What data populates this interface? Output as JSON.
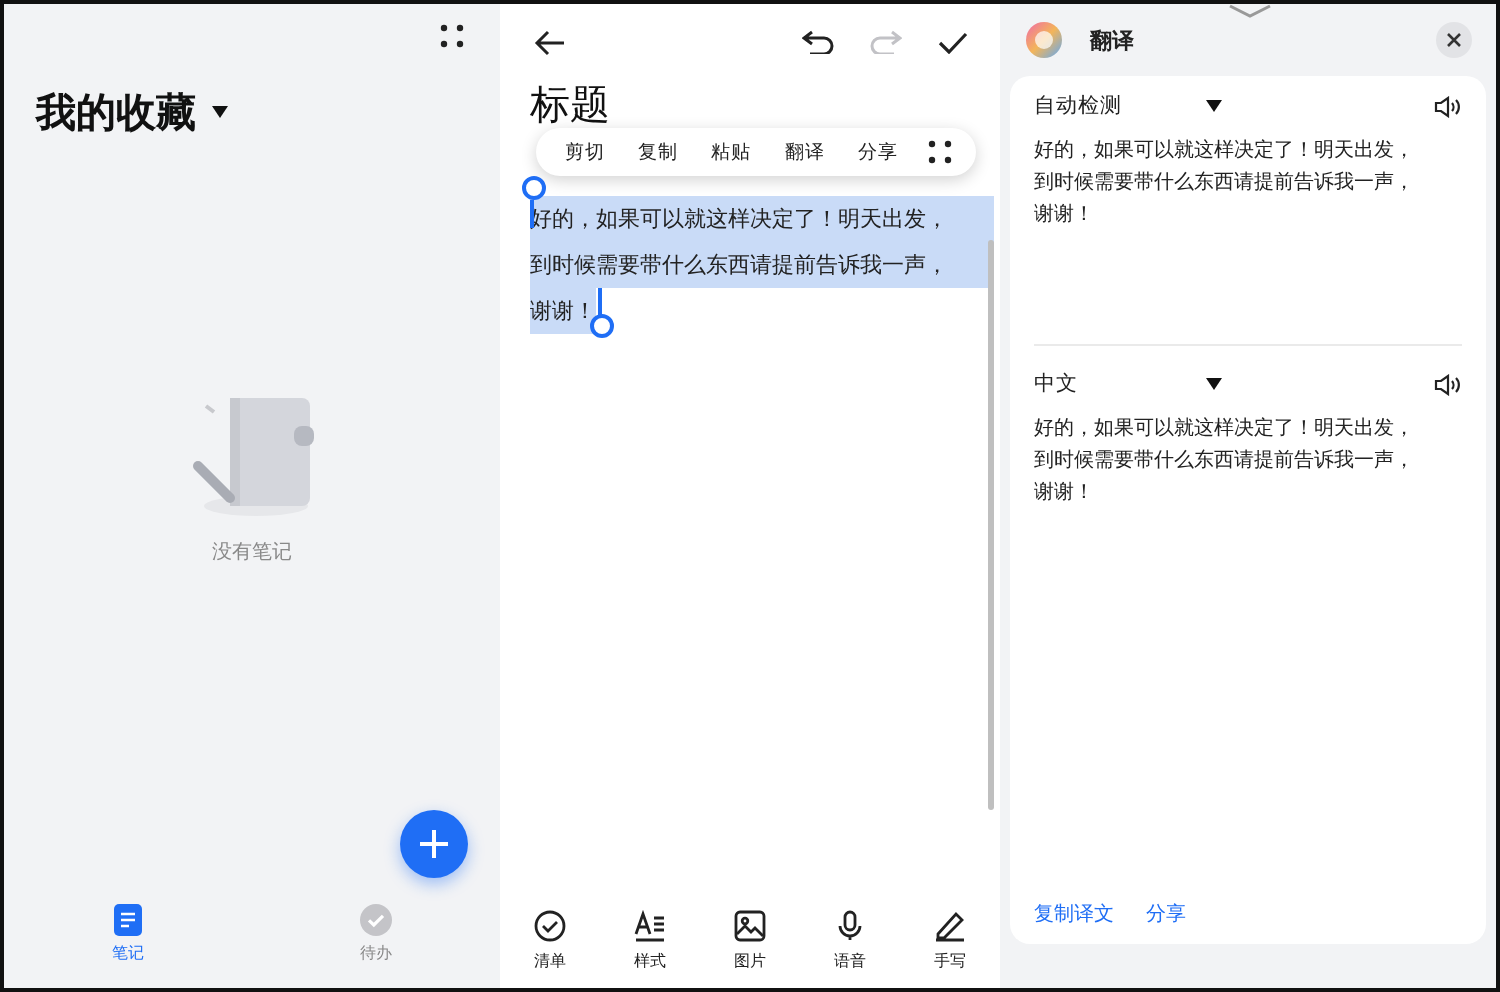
{
  "notes_list": {
    "title": "我的收藏",
    "empty_text": "没有笔记",
    "bottom_tabs": [
      {
        "kind": "notes",
        "label": "笔记",
        "selected": true
      },
      {
        "kind": "todo",
        "label": "待办",
        "selected": false
      }
    ]
  },
  "editor": {
    "top_actions": [
      {
        "kind": "undo",
        "disabled": false
      },
      {
        "kind": "redo",
        "disabled": true
      },
      {
        "kind": "done",
        "disabled": false
      }
    ],
    "title": "标题",
    "context_menu": [
      "剪切",
      "复制",
      "粘贴",
      "翻译",
      "分享"
    ],
    "selected_text_lines": [
      "好的，如果可以就这样决定了！明天出发，",
      "到时候需要带什么东西请提前告诉我一声，",
      "谢谢！"
    ],
    "tools": [
      {
        "kind": "checklist",
        "label": "清单"
      },
      {
        "kind": "style",
        "label": "样式"
      },
      {
        "kind": "image",
        "label": "图片"
      },
      {
        "kind": "voice",
        "label": "语音"
      },
      {
        "kind": "handwriting",
        "label": "手写"
      }
    ]
  },
  "translate": {
    "title": "翻译",
    "source": {
      "language": "自动检测",
      "lines": [
        "好的，如果可以就这样决定了！明天出发，",
        "到时候需要带什么东西请提前告诉我一声，",
        "谢谢！"
      ]
    },
    "target": {
      "language": "中文",
      "lines": [
        "好的，如果可以就这样决定了！明天出发，",
        "到时候需要带什么东西请提前告诉我一声，",
        "谢谢！"
      ]
    },
    "actions": [
      "复制译文",
      "分享"
    ]
  }
}
